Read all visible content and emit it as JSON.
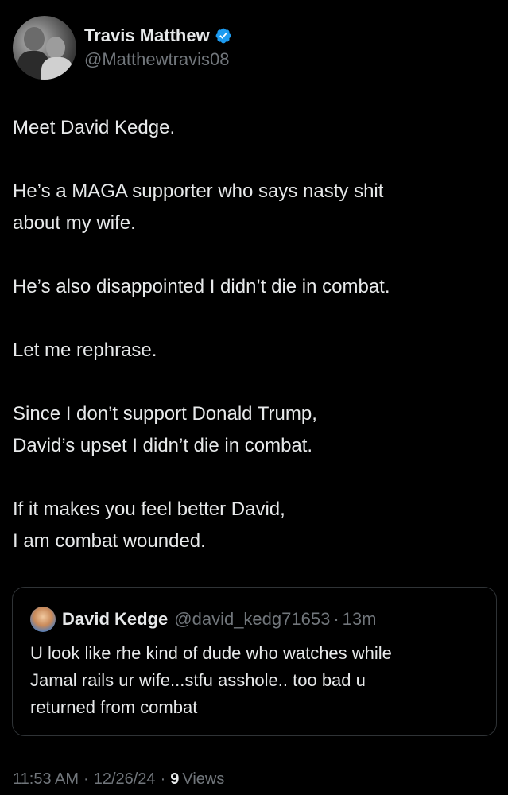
{
  "author": {
    "display_name": "Travis Matthew",
    "handle": "@Matthewtravis08",
    "verified_icon": "verified-badge-icon",
    "verified_color": "#1d9bf0"
  },
  "body": {
    "paragraphs": [
      [
        "Meet David Kedge."
      ],
      [
        "He’s a MAGA supporter who says nasty shit",
        "about my wife."
      ],
      [
        "He’s also disappointed I didn’t die in combat."
      ],
      [
        "Let me rephrase."
      ],
      [
        "Since I don’t support Donald Trump,",
        "David’s upset I didn’t die in combat."
      ],
      [
        "If it makes you feel better David,",
        "I am combat wounded."
      ]
    ]
  },
  "quote": {
    "display_name": "David Kedge",
    "handle": "@david_kedg71653",
    "separator": "·",
    "time": "13m",
    "lines": [
      "U look like rhe kind of dude who watches while",
      "Jamal rails ur wife...stfu asshole.. too bad u",
      "returned from combat"
    ]
  },
  "meta": {
    "time": "11:53 AM",
    "separator": "·",
    "date": "12/26/24",
    "views_count": "9",
    "views_label": "Views"
  },
  "colors": {
    "background": "#000000",
    "text": "#e7e9ea",
    "secondary_text": "#71767b",
    "border": "#2f3336"
  }
}
